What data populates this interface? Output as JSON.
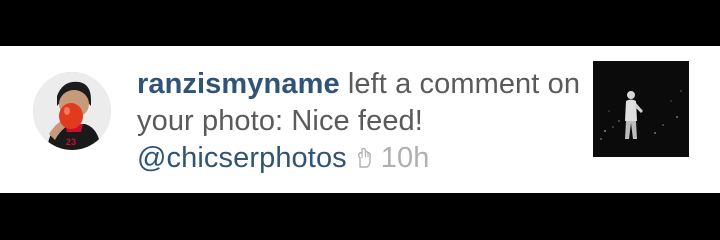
{
  "notification": {
    "username": "ranzismyname",
    "action_text": "left a comment on your photo: Nice feed!",
    "mention": "@chicserphotos",
    "time_icon": "clock-hand-icon",
    "timestamp": "10h"
  },
  "avatar": {
    "icon": "user-avatar"
  },
  "thumbnail": {
    "icon": "photo-thumbnail"
  },
  "colors": {
    "background": "#000000",
    "row": "#ffffff",
    "username": "#2f5478",
    "body_text": "#5a5a5a",
    "timestamp": "#b0b0b0"
  }
}
